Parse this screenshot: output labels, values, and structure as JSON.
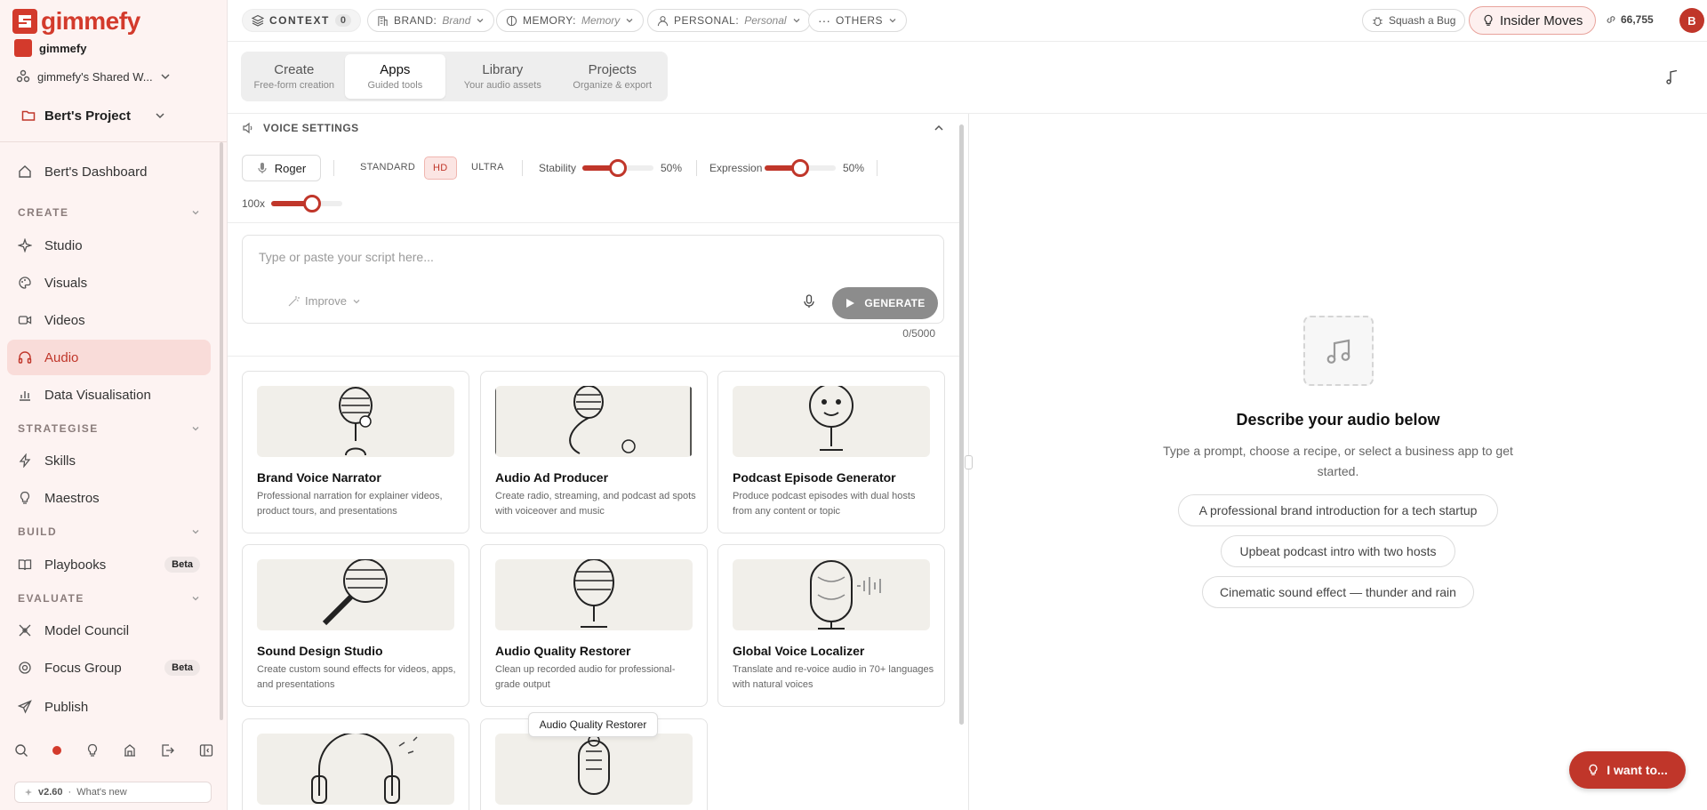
{
  "brand": {
    "logo_text": "gimmefy",
    "org_name": "gimmefy",
    "accent_color": "#c0362a"
  },
  "workspace": {
    "label": "gimmefy's Shared W..."
  },
  "project": {
    "label": "Bert's Project"
  },
  "sidebar": {
    "dashboard": "Bert's Dashboard",
    "sections": {
      "create": "CREATE",
      "strategise": "STRATEGISE",
      "build": "BUILD",
      "evaluate": "EVALUATE"
    },
    "items": {
      "studio": "Studio",
      "visuals": "Visuals",
      "videos": "Videos",
      "audio": "Audio",
      "data_vis": "Data Visualisation",
      "skills": "Skills",
      "maestros": "Maestros",
      "playbooks": "Playbooks",
      "model_council": "Model Council",
      "focus_group": "Focus Group",
      "publish": "Publish"
    },
    "badges": {
      "playbooks": "Beta",
      "focus_group": "Beta"
    },
    "version": "v2.60",
    "whats_new": "What's new"
  },
  "topbar": {
    "context_label": "CONTEXT",
    "context_count": "0",
    "brand_key": "BRAND:",
    "brand_value": "Brand",
    "memory_key": "MEMORY:",
    "memory_value": "Memory",
    "personal_key": "PERSONAL:",
    "personal_value": "Personal",
    "others": "OTHERS",
    "squash": "Squash a Bug",
    "insider": "Insider Moves",
    "credits": "66,755",
    "avatar": "B"
  },
  "tabs": [
    {
      "title": "Create",
      "subtitle": "Free-form creation"
    },
    {
      "title": "Apps",
      "subtitle": "Guided tools"
    },
    {
      "title": "Library",
      "subtitle": "Your audio assets"
    },
    {
      "title": "Projects",
      "subtitle": "Organize & export"
    }
  ],
  "voice_settings": {
    "header": "VOICE SETTINGS",
    "voice": "Roger",
    "quality": {
      "standard": "STANDARD",
      "hd": "HD",
      "ultra": "ULTRA",
      "selected": "HD"
    },
    "stability_label": "Stability",
    "stability_value": "50%",
    "stability_fraction": 0.5,
    "expression_label": "Expression",
    "expression_value": "50%",
    "expression_fraction": 0.5,
    "speed_label": "100x",
    "speed_fraction": 0.58
  },
  "script": {
    "placeholder": "Type or paste your script here...",
    "improve": "Improve",
    "generate": "GENERATE",
    "char_count": "0/5000"
  },
  "apps": [
    {
      "title": "Brand Voice Narrator",
      "description": "Professional narration for explainer videos, product tours, and presentations"
    },
    {
      "title": "Audio Ad Producer",
      "description": "Create radio, streaming, and podcast ad spots with voiceover and music"
    },
    {
      "title": "Podcast Episode Generator",
      "description": "Produce podcast episodes with dual hosts from any content or topic"
    },
    {
      "title": "Sound Design Studio",
      "description": "Create custom sound effects for videos, apps, and presentations"
    },
    {
      "title": "Audio Quality Restorer",
      "description": "Clean up recorded audio for professional-grade output"
    },
    {
      "title": "Global Voice Localizer",
      "description": "Translate and re-voice audio in 70+ languages with natural voices"
    }
  ],
  "tooltip": "Audio Quality Restorer",
  "right_pane": {
    "title": "Describe your audio below",
    "subtitle": "Type a prompt, choose a recipe, or select a business app to get started.",
    "suggestions": [
      "A professional brand introduction for a tech startup",
      "Upbeat podcast intro with two hosts",
      "Cinematic sound effect — thunder and rain"
    ]
  },
  "fab": {
    "label": "I want to..."
  }
}
